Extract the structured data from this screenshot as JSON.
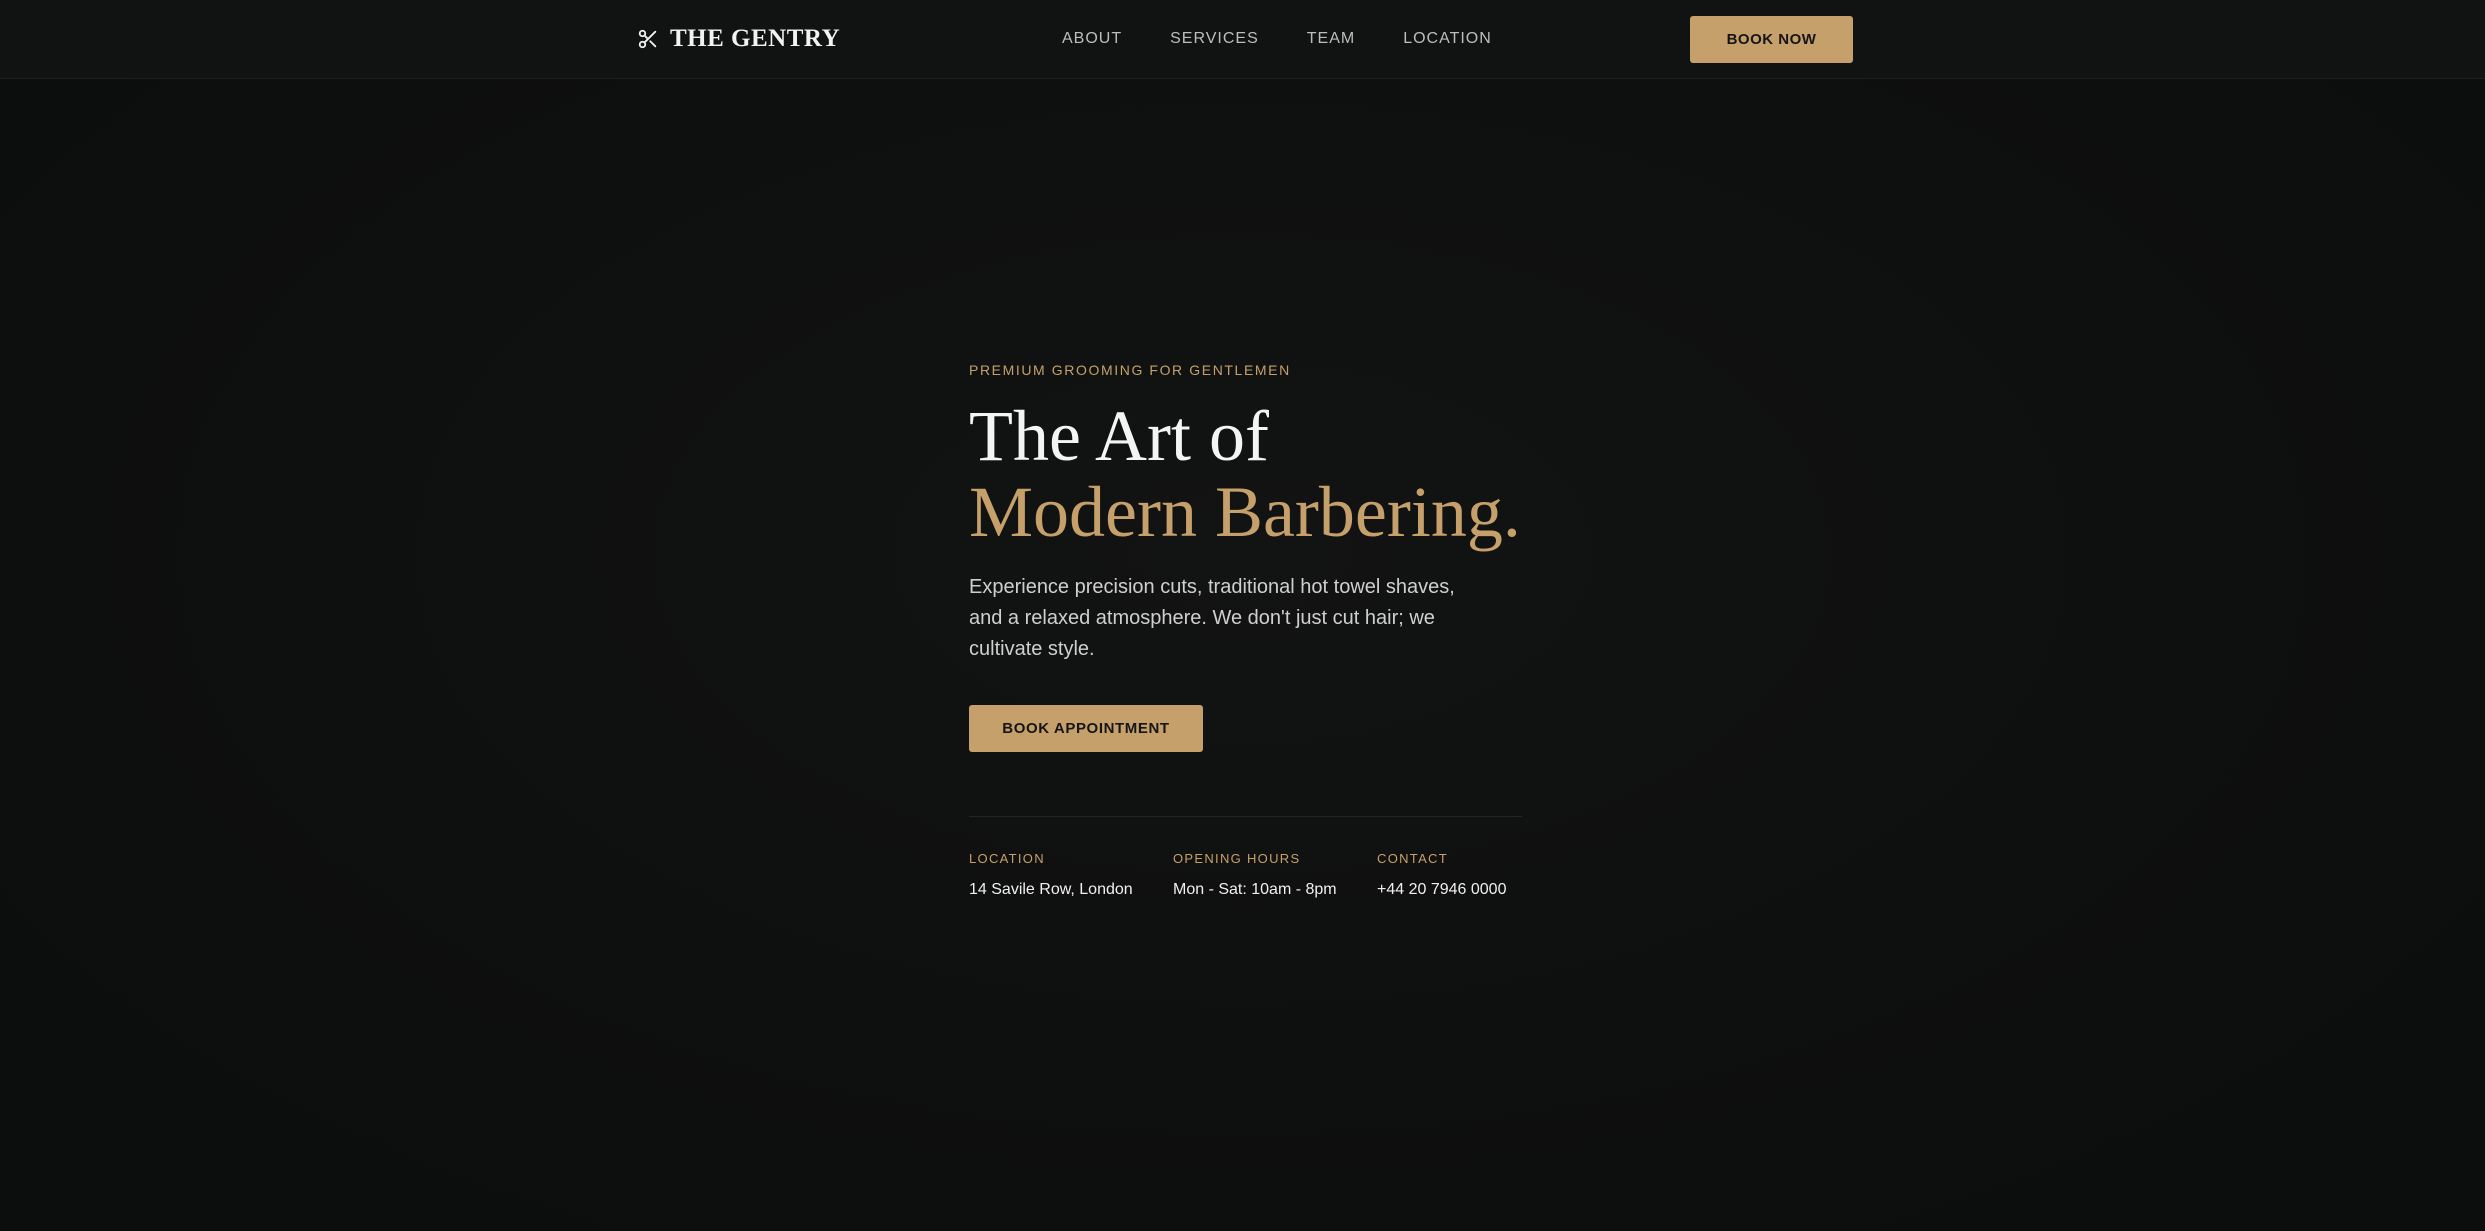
{
  "header": {
    "brand": "THE GENTRY",
    "brand_icon": "scissors-icon",
    "nav": [
      {
        "label": "ABOUT"
      },
      {
        "label": "SERVICES"
      },
      {
        "label": "TEAM"
      },
      {
        "label": "LOCATION"
      }
    ],
    "cta_label": "BOOK NOW"
  },
  "hero": {
    "eyebrow": "PREMIUM GROOMING FOR GENTLEMEN",
    "headline_line1": "The Art of",
    "headline_line2": "Modern Barbering.",
    "description": "Experience precision cuts, traditional hot towel shaves, and a relaxed atmosphere. We don't just cut hair; we cultivate style.",
    "cta_label": "BOOK APPOINTMENT"
  },
  "info": [
    {
      "label": "LOCATION",
      "value": "14 Savile Row, London"
    },
    {
      "label": "OPENING HOURS",
      "value": "Mon - Sat: 10am - 8pm"
    },
    {
      "label": "CONTACT",
      "value": "+44 20 7946 0000"
    }
  ],
  "colors": {
    "accent": "#c6a06a",
    "background": "#0e0f0f",
    "header_background": "#111212",
    "text_primary": "#f4f4f4",
    "text_muted": "#bdbdbd"
  }
}
